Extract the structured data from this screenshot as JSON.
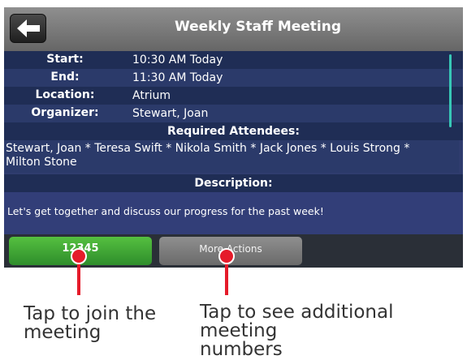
{
  "header": {
    "title": "Weekly Staff Meeting",
    "back_icon": "back-arrow-icon"
  },
  "details": [
    {
      "label": "Start:",
      "value": "10:30 AM Today"
    },
    {
      "label": "End:",
      "value": "11:30 AM Today"
    },
    {
      "label": "Location:",
      "value": "Atrium"
    },
    {
      "label": "Organizer:",
      "value": "Stewart, Joan"
    }
  ],
  "attendees": {
    "heading": "Required Attendees:",
    "line1": "Stewart, Joan * Teresa Swift * Nikola Smith * Jack Jones * Louis Strong *",
    "line2": "Milton Stone"
  },
  "description": {
    "heading": "Description:",
    "text": "Let's get together and discuss our progress for the past week!"
  },
  "buttons": {
    "join": "12345",
    "more": "More Actions"
  },
  "callouts": {
    "join_line1": "Tap to join the",
    "join_line2": "meeting",
    "more_line1": "Tap to see additional meeting",
    "more_line2": "numbers"
  },
  "colors": {
    "callout": "#e51b2a",
    "join_button": "#3fa535",
    "scroll_accent": "#37c7b6"
  }
}
